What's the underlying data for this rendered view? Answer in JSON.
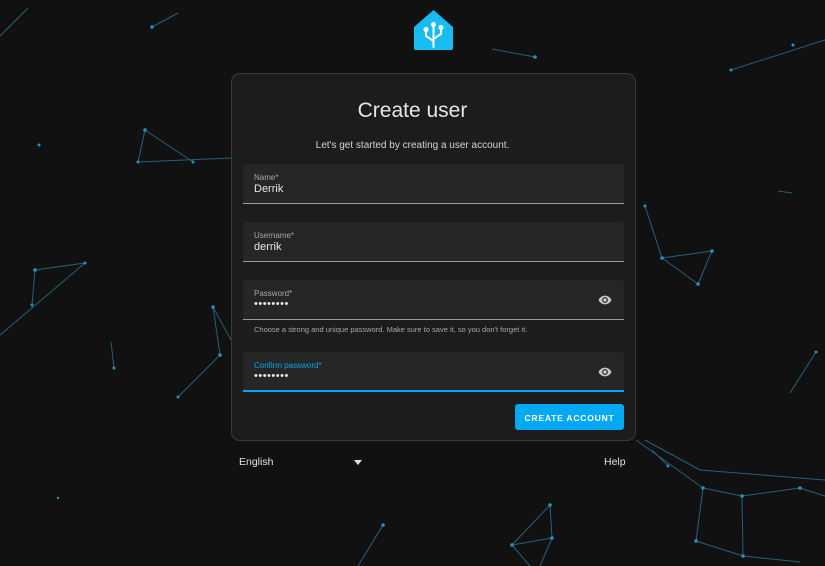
{
  "colors": {
    "accent": "#03a9f4",
    "background": "#111111",
    "card": "#1c1c1c",
    "field": "#262626"
  },
  "logo": {
    "icon": "home-assistant-logo-icon"
  },
  "card": {
    "title": "Create user",
    "subtitle": "Let's get started by creating a user account."
  },
  "fields": {
    "name": {
      "label": "Name*",
      "value": "Derrik"
    },
    "username": {
      "label": "Username*",
      "value": "derrik"
    },
    "password": {
      "label": "Password*",
      "value": "••••••••",
      "helper": "Choose a strong and unique password. Make sure to save it, so you don't forget it.",
      "icon": "eye-icon"
    },
    "confirm_password": {
      "label": "Confirm password*",
      "value": "••••••••",
      "icon": "eye-icon"
    }
  },
  "actions": {
    "create_account": "CREATE ACCOUNT"
  },
  "footer": {
    "language": "English",
    "language_icon": "chevron-down-icon",
    "help": "Help"
  }
}
